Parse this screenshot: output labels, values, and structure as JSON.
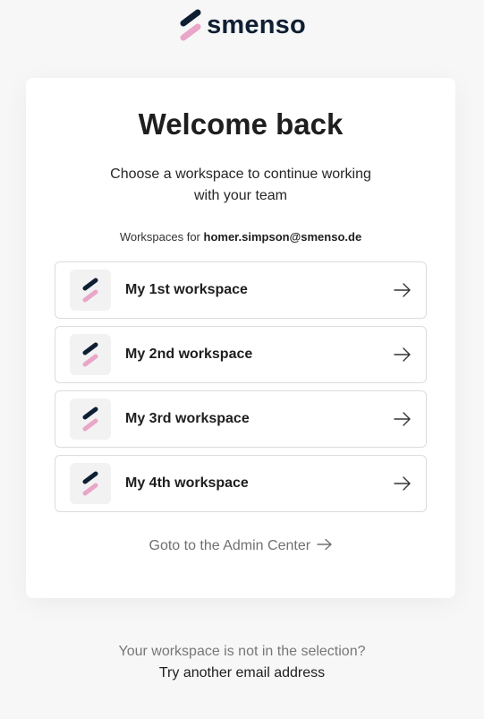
{
  "brand": {
    "name": "smenso"
  },
  "card": {
    "title": "Welcome back",
    "subtitle": "Choose a workspace to continue working with your team",
    "workspaces_prefix": "Workspaces for",
    "email": "homer.simpson@smenso.de",
    "workspaces": [
      {
        "name": "My 1st workspace"
      },
      {
        "name": "My 2nd workspace"
      },
      {
        "name": "My 3rd workspace"
      },
      {
        "name": "My 4th workspace"
      }
    ],
    "admin_link": "Goto to the Admin Center"
  },
  "footer": {
    "question": "Your workspace is not in the selection?",
    "alt_email_link": "Try another email address"
  },
  "colors": {
    "navy": "#0f1f33",
    "pink": "#e9a6c8",
    "background": "#f7f7f7"
  },
  "icons": [
    "smenso-logo-icon",
    "workspace-logo-icon",
    "arrow-right-icon"
  ]
}
